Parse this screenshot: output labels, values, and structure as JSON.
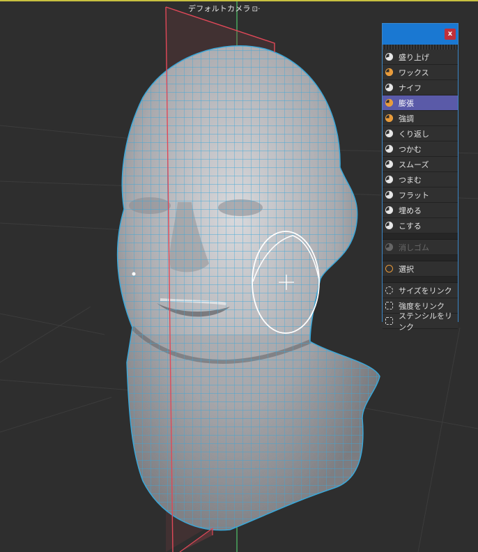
{
  "viewport": {
    "camera_label": "デフォルトカメラ",
    "camera_icon": "camera-link-icon",
    "accent_color": "#3ba7d8",
    "plane_color": "#e04858"
  },
  "palette": {
    "close_label": "x",
    "sculpt_tools": [
      {
        "label": "盛り上げ",
        "icon": "build-icon"
      },
      {
        "label": "ワックス",
        "icon": "wax-icon"
      },
      {
        "label": "ナイフ",
        "icon": "knife-icon"
      },
      {
        "label": "膨張",
        "icon": "inflate-icon",
        "active": true
      },
      {
        "label": "強調",
        "icon": "pinch-icon"
      },
      {
        "label": "くり返し",
        "icon": "repeat-icon"
      },
      {
        "label": "つかむ",
        "icon": "grab-icon"
      },
      {
        "label": "スムーズ",
        "icon": "smooth-icon"
      },
      {
        "label": "つまむ",
        "icon": "pinch2-icon"
      },
      {
        "label": "フラット",
        "icon": "flatten-icon"
      },
      {
        "label": "埋める",
        "icon": "fill-icon"
      },
      {
        "label": "こする",
        "icon": "scrape-icon"
      }
    ],
    "eraser": {
      "label": "消しゴム",
      "icon": "eraser-icon"
    },
    "select": {
      "label": "選択",
      "icon": "select-icon"
    },
    "links": [
      {
        "label": "サイズをリンク",
        "icon": "size-link-icon"
      },
      {
        "label": "強度をリンク",
        "icon": "strength-link-icon"
      },
      {
        "label": "ステンシルをリンク",
        "icon": "stencil-link-icon"
      }
    ]
  }
}
